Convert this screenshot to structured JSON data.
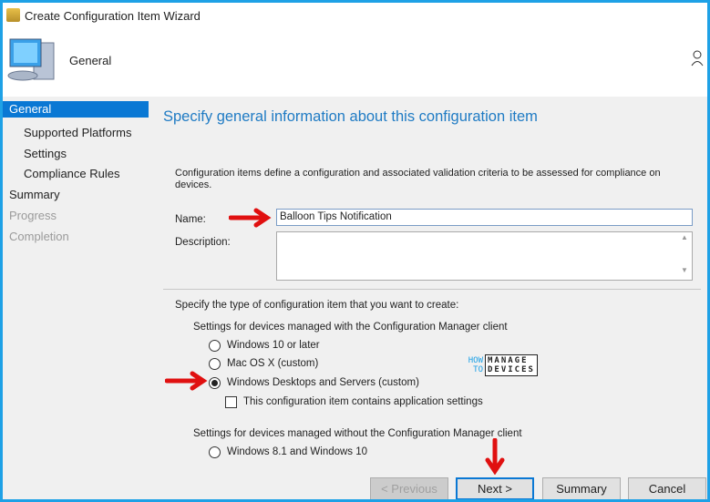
{
  "window": {
    "title": "Create Configuration Item Wizard",
    "header": "General"
  },
  "nav": [
    {
      "label": "General",
      "state": "selected"
    },
    {
      "label": "Supported Platforms",
      "state": "sub"
    },
    {
      "label": "Settings",
      "state": "sub"
    },
    {
      "label": "Compliance Rules",
      "state": "sub"
    },
    {
      "label": "Summary",
      "state": "normal"
    },
    {
      "label": "Progress",
      "state": "disabled"
    },
    {
      "label": "Completion",
      "state": "disabled"
    }
  ],
  "main": {
    "heading": "Specify general information about this configuration item",
    "intro": "Configuration items define a configuration and associated validation criteria to be assessed for compliance on devices.",
    "name_label": "Name:",
    "name_value": "Balloon Tips Notification",
    "description_label": "Description:",
    "description_value": "",
    "type_prompt": "Specify the type of configuration item that you want to create:",
    "client_group": "Settings for devices managed with the Configuration Manager client",
    "options": [
      {
        "label": "Windows 10 or later",
        "checked": false
      },
      {
        "label": "Mac OS X (custom)",
        "checked": false
      },
      {
        "label": "Windows Desktops and Servers (custom)",
        "checked": true
      }
    ],
    "app_settings_label": "This configuration item contains application settings",
    "app_settings_checked": false,
    "noclient_group": "Settings for devices managed without the Configuration Manager client",
    "noclient_option": "Windows 8.1 and Windows 10"
  },
  "watermark": {
    "how": "HOW",
    "to": "TO",
    "manage": "MANAGE",
    "devices": "DEVICES"
  },
  "buttons": {
    "previous": "< Previous",
    "next": "Next >",
    "summary": "Summary",
    "cancel": "Cancel"
  },
  "colors": {
    "border": "#1ea1e6",
    "accent": "#0a78d4",
    "heading": "#1f7bc4",
    "arrow": "#e01010"
  }
}
